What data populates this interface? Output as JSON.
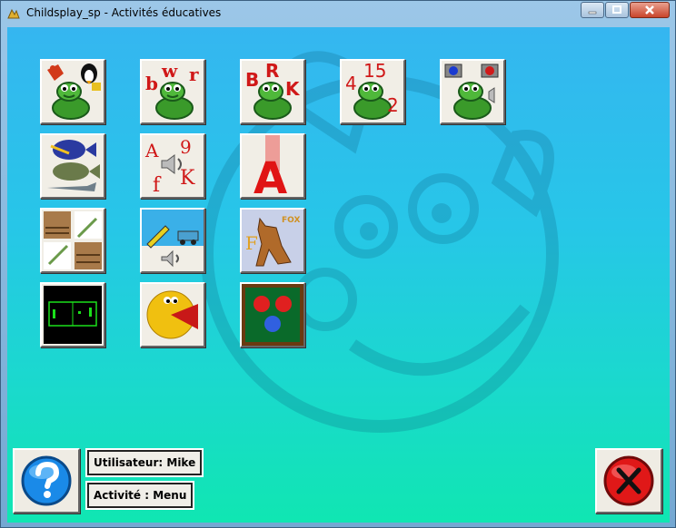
{
  "window": {
    "title": "Childsplay_sp - Activités éducatives"
  },
  "tiles": [
    {
      "name": "memory-game-tile",
      "icon": "turtle-with-crab-and-penguin"
    },
    {
      "name": "lowercase-letters-tile",
      "icon": "turtle-with-letters",
      "letters": [
        "b",
        "w",
        "r"
      ]
    },
    {
      "name": "uppercase-letters-tile",
      "icon": "turtle-with-letters",
      "letters": [
        "B",
        "R",
        "K"
      ]
    },
    {
      "name": "numbers-tile",
      "icon": "turtle-with-numbers",
      "letters": [
        "4",
        "15",
        "2"
      ]
    },
    {
      "name": "sound-memory-tile",
      "icon": "turtle-with-buttons"
    },
    {
      "name": "fish-tile",
      "icon": "fish"
    },
    {
      "name": "letter-sounds-tile",
      "icon": "letters-with-speaker",
      "letters": [
        "A",
        "9",
        "f",
        "K"
      ]
    },
    {
      "name": "letter-flash-tile",
      "icon": "red-letter",
      "letters": [
        "A"
      ]
    },
    {
      "name": "puzzle-tile",
      "icon": "puzzle"
    },
    {
      "name": "travel-tile",
      "icon": "rocket-and-car"
    },
    {
      "name": "fox-tile",
      "icon": "fox",
      "letters": [
        "F",
        "FOX"
      ]
    },
    {
      "name": "pong-tile",
      "icon": "pong"
    },
    {
      "name": "pacman-tile",
      "icon": "pacman"
    },
    {
      "name": "billiards-tile",
      "icon": "billiard-balls"
    }
  ],
  "user_label": "Utilisateur: Mike",
  "activity_label": "Activité : Menu",
  "help_button": {
    "icon": "question-icon"
  },
  "quit_button": {
    "icon": "close-x-icon"
  }
}
